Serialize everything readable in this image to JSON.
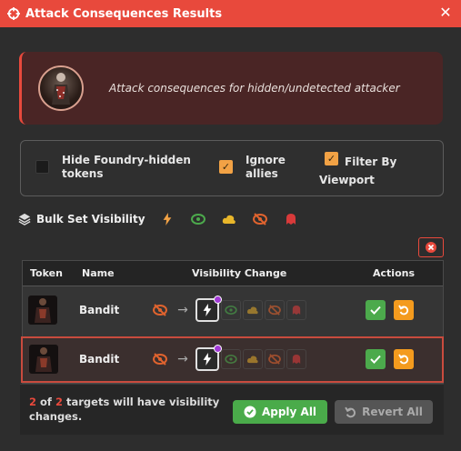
{
  "window": {
    "title": "Attack Consequences Results",
    "close_icon": "close-icon",
    "title_icon": "crosshair-icon",
    "accent": "#e8493c"
  },
  "banner": {
    "message": "Attack consequences for hidden/undetected attacker"
  },
  "filters": {
    "hide_foundry_hidden": {
      "label_line1": "Hide Foundry-hidden",
      "label_line2": "tokens",
      "checked": false
    },
    "ignore_allies": {
      "label_line1": "Ignore",
      "label_line2": "allies",
      "checked": true
    },
    "filter_by_viewport": {
      "label_line1": "Filter By",
      "label_line2": "Viewport",
      "checked": true
    }
  },
  "toolbar": {
    "bulk_label": "Bulk Set Visibility",
    "buttons": [
      "lightning-icon",
      "eye-icon",
      "cloud-icon",
      "eye-slash-icon",
      "ghost-icon"
    ],
    "clear_icon": "x-circle-icon"
  },
  "table": {
    "headers": {
      "token": "Token",
      "name": "Name",
      "visibility": "Visibility Change",
      "actions": "Actions"
    },
    "rows": [
      {
        "name": "Bandit",
        "current": "eye-slash-icon",
        "selected": "lightning-icon",
        "highlighted": false
      },
      {
        "name": "Bandit",
        "current": "eye-slash-icon",
        "selected": "lightning-icon",
        "highlighted": true
      }
    ],
    "colors": {
      "observed": "#4caa4c",
      "concealed": "#d9a42b",
      "hidden": "#e0632e",
      "undetected": "#d83a3a"
    }
  },
  "footer": {
    "count_changed": "2",
    "of_text": "of",
    "count_total": "2",
    "message": "targets will have visibility changes.",
    "apply_label": "Apply All",
    "revert_label": "Revert All"
  }
}
